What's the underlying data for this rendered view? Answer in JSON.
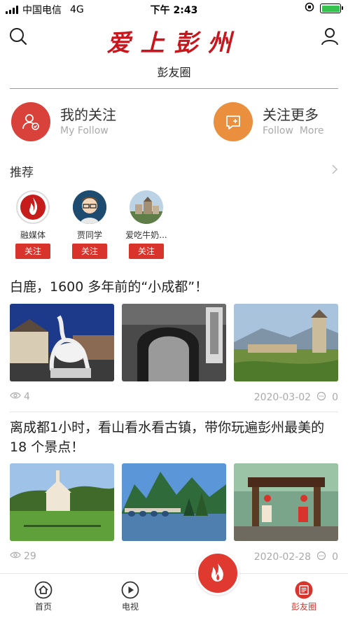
{
  "status_bar": {
    "carrier": "中国电信",
    "network": "4G",
    "time": "下午 2:43"
  },
  "header": {
    "logo_text": "爱上彭州",
    "search_icon": "search-icon",
    "user_icon": "user-icon"
  },
  "page": {
    "title": "彭友圈"
  },
  "follow": {
    "my": {
      "title": "我的关注",
      "subtitle": "My Follow",
      "color": "#d8423a",
      "icon": "user-check-icon"
    },
    "more": {
      "title": "关注更多",
      "subtitle": "Follow  More",
      "color": "#ea8f3d",
      "icon": "chat-plus-icon"
    }
  },
  "recommend": {
    "title": "推荐",
    "users": [
      {
        "name": "融媒体",
        "button": "关注"
      },
      {
        "name": "贾同学",
        "button": "关注"
      },
      {
        "name": "爱吃牛奶...",
        "button": "关注"
      }
    ]
  },
  "articles": [
    {
      "title": "白鹿，1600 多年前的“小成都”！",
      "views": "4",
      "date": "2020-03-02",
      "comments": "0"
    },
    {
      "title": "离成都1小时，看山看水看古镇，带你玩遍彭州最美的 18 个景点！",
      "views": "29",
      "date": "2020-02-28",
      "comments": "0"
    }
  ],
  "tabbar": {
    "tabs": [
      {
        "label": "首页",
        "icon": "home-icon"
      },
      {
        "label": "电视",
        "icon": "play-icon"
      },
      {
        "label": "彭友圈",
        "icon": "news-icon"
      }
    ],
    "center_icon": "flame-logo-icon",
    "active_color": "#d8342c"
  }
}
